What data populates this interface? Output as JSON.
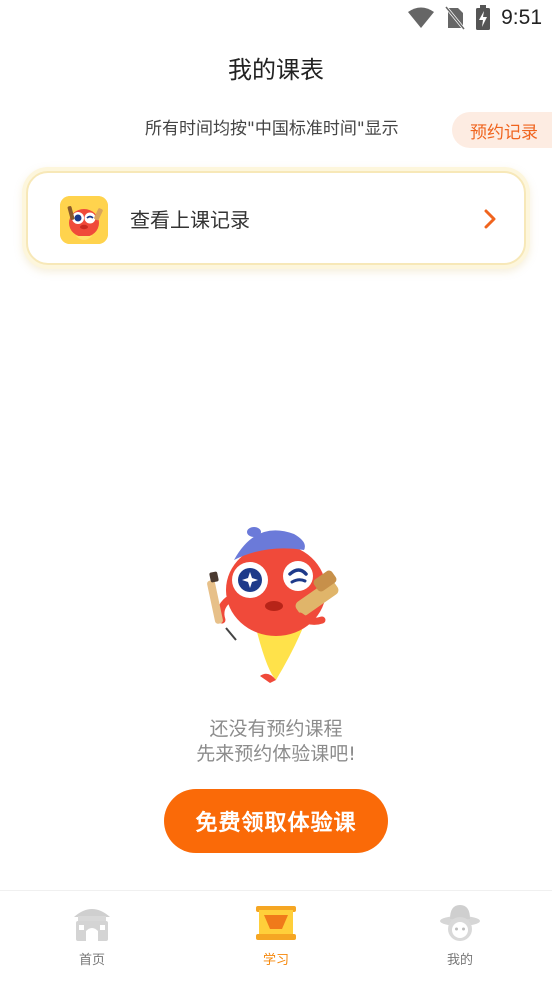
{
  "status_bar": {
    "time": "9:51",
    "icons": [
      "wifi-icon",
      "no-sim-icon",
      "battery-charging-icon"
    ]
  },
  "header": {
    "title": "我的课表",
    "timezone_note": "所有时间均按\"中国标准时间\"显示",
    "booking_record_label": "预约记录"
  },
  "record_card": {
    "label": "查看上课记录",
    "icon": "mascot-app-icon",
    "chevron_icon": "chevron-right-icon"
  },
  "empty_state": {
    "line1": "还没有预约课程",
    "line2": "先来预约体验课吧!",
    "button_label": "免费领取体验课",
    "illustration": "mascot-illustration"
  },
  "bottom_nav": {
    "items": [
      {
        "label": "首页",
        "icon": "home-icon",
        "active": false
      },
      {
        "label": "学习",
        "icon": "study-scroll-icon",
        "active": true
      },
      {
        "label": "我的",
        "icon": "profile-icon",
        "active": false
      }
    ]
  },
  "colors": {
    "accent": "#fa6a08",
    "accent_light": "#fdece2",
    "nav_active": "#f5870a",
    "text_muted": "#8c8c8c",
    "card_border": "#f7e8b8"
  }
}
